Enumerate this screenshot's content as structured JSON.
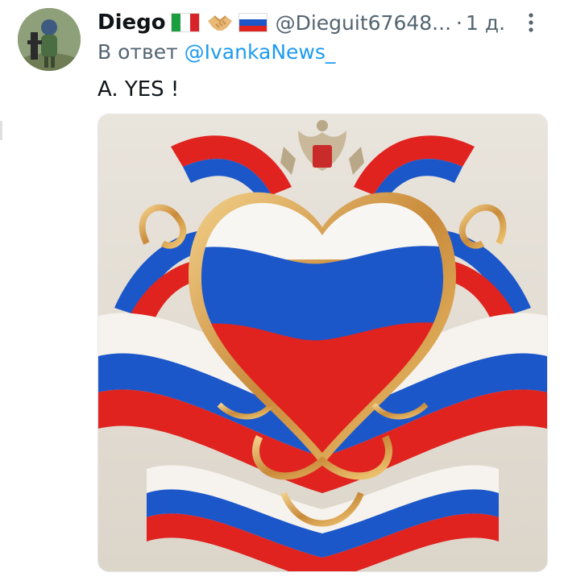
{
  "author": {
    "name": "Diego",
    "handle": "@Dieguit67648...",
    "separator": "·",
    "time": "1 д."
  },
  "reply": {
    "prefix": "В ответ",
    "mention": "@IvankaNews_"
  },
  "tweet": {
    "text": "A. YES !"
  },
  "icons": {
    "flag_italy": "italy-flag-icon",
    "handshake": "handshake-icon",
    "flag_russia": "russia-flag-icon",
    "more": "more-options-icon"
  },
  "colors": {
    "text": "#0f1419",
    "secondary": "#536471",
    "link": "#1d9bf0",
    "russia_white": "#ffffff",
    "russia_blue": "#1c57c9",
    "russia_red": "#e0231f"
  }
}
